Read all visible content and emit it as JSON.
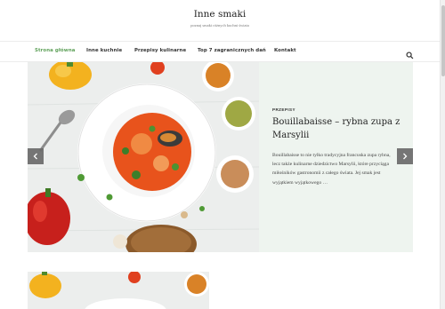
{
  "site": {
    "title": "Inne smaki",
    "tagline": "poznaj smaki różnych kuchni świata"
  },
  "nav": {
    "items": [
      {
        "label": "Strona główna",
        "active": true
      },
      {
        "label": "Inne kuchnie",
        "active": false
      },
      {
        "label": "Przepisy kulinarne",
        "active": false
      },
      {
        "label": "Top 7 zagranicznych dań",
        "active": false
      },
      {
        "label": "Kontakt",
        "active": false
      }
    ],
    "search_icon": "search-icon"
  },
  "slider": {
    "slide": {
      "category": "PRZEPISY",
      "title": "Bouillabaisse – rybna zupa z Marsylii",
      "excerpt": "Bouillabaisse to nie tylko tradycyjna francuska zupa rybna, lecz także kulinarne dziedzictwo Marsylii, które przyciąga miłośników gastronomii z całego świata. Jej smak jest wyjątkiem wyjątkowego …"
    },
    "prev_icon": "chevron-left-icon",
    "next_icon": "chevron-right-icon"
  },
  "colors": {
    "accent": "#5fa15a",
    "panel": "#eef4ef",
    "arrow": "#6b6b6b"
  }
}
